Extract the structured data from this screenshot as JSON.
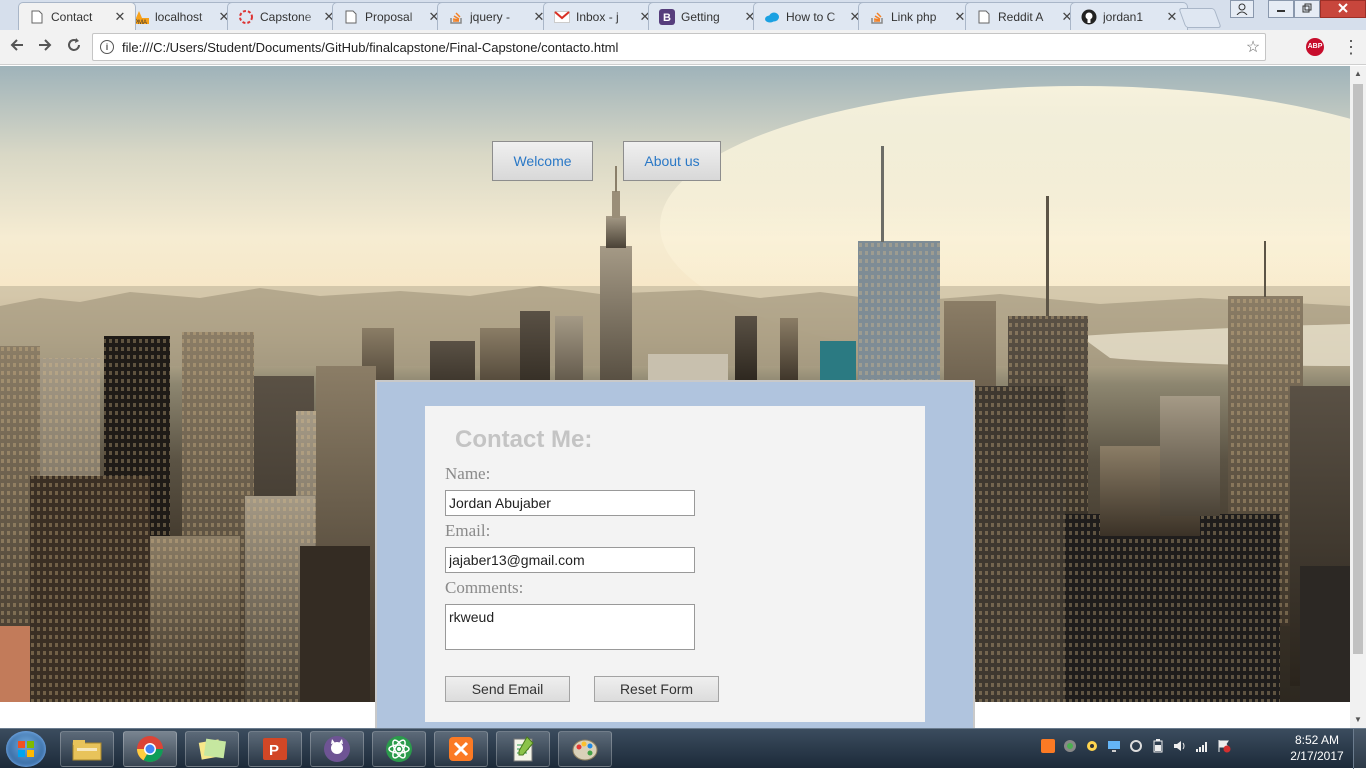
{
  "browser": {
    "tabs": [
      {
        "title": "Contact",
        "icon": "page-icon",
        "active": true
      },
      {
        "title": "localhost",
        "icon": "phpmyadmin-icon",
        "active": false
      },
      {
        "title": "Capstone",
        "icon": "loading-icon",
        "active": false
      },
      {
        "title": "Proposal",
        "icon": "page-icon",
        "active": false
      },
      {
        "title": "jquery -",
        "icon": "stackoverflow-icon",
        "active": false
      },
      {
        "title": "Inbox - j",
        "icon": "gmail-icon",
        "active": false
      },
      {
        "title": "Getting",
        "icon": "bootstrap-icon",
        "active": false
      },
      {
        "title": "How to C",
        "icon": "cloud-icon",
        "active": false
      },
      {
        "title": "Link php",
        "icon": "stackoverflow-icon",
        "active": false
      },
      {
        "title": "Reddit A",
        "icon": "page-icon",
        "active": false
      },
      {
        "title": "jordan1",
        "icon": "github-icon",
        "active": false
      }
    ],
    "tab_close_glyph": "✕",
    "address": "file:///C:/Users/Student/Documents/GitHub/finalcapstone/Final-Capstone/contacto.html",
    "abp_label": "ABP"
  },
  "page": {
    "nav": {
      "welcome_label": "Welcome",
      "about_label": "About us"
    },
    "form": {
      "title": "Contact Me:",
      "name_label": "Name:",
      "name_value": "Jordan Abujaber",
      "email_label": "Email:",
      "email_value": "jajaber13@gmail.com",
      "comments_label": "Comments:",
      "comments_value": "rkweud",
      "send_label": "Send Email",
      "reset_label": "Reset Form"
    }
  },
  "taskbar": {
    "apps": [
      {
        "name": "file-explorer"
      },
      {
        "name": "chrome"
      },
      {
        "name": "sticky-notes"
      },
      {
        "name": "powerpoint"
      },
      {
        "name": "github-desktop"
      },
      {
        "name": "atom"
      },
      {
        "name": "xampp"
      },
      {
        "name": "notepad-plus-plus"
      },
      {
        "name": "paint"
      }
    ],
    "time": "8:52 AM",
    "date": "2/17/2017"
  },
  "colors": {
    "panel_bg": "#b0c4de",
    "link_blue": "#2a78c6"
  }
}
